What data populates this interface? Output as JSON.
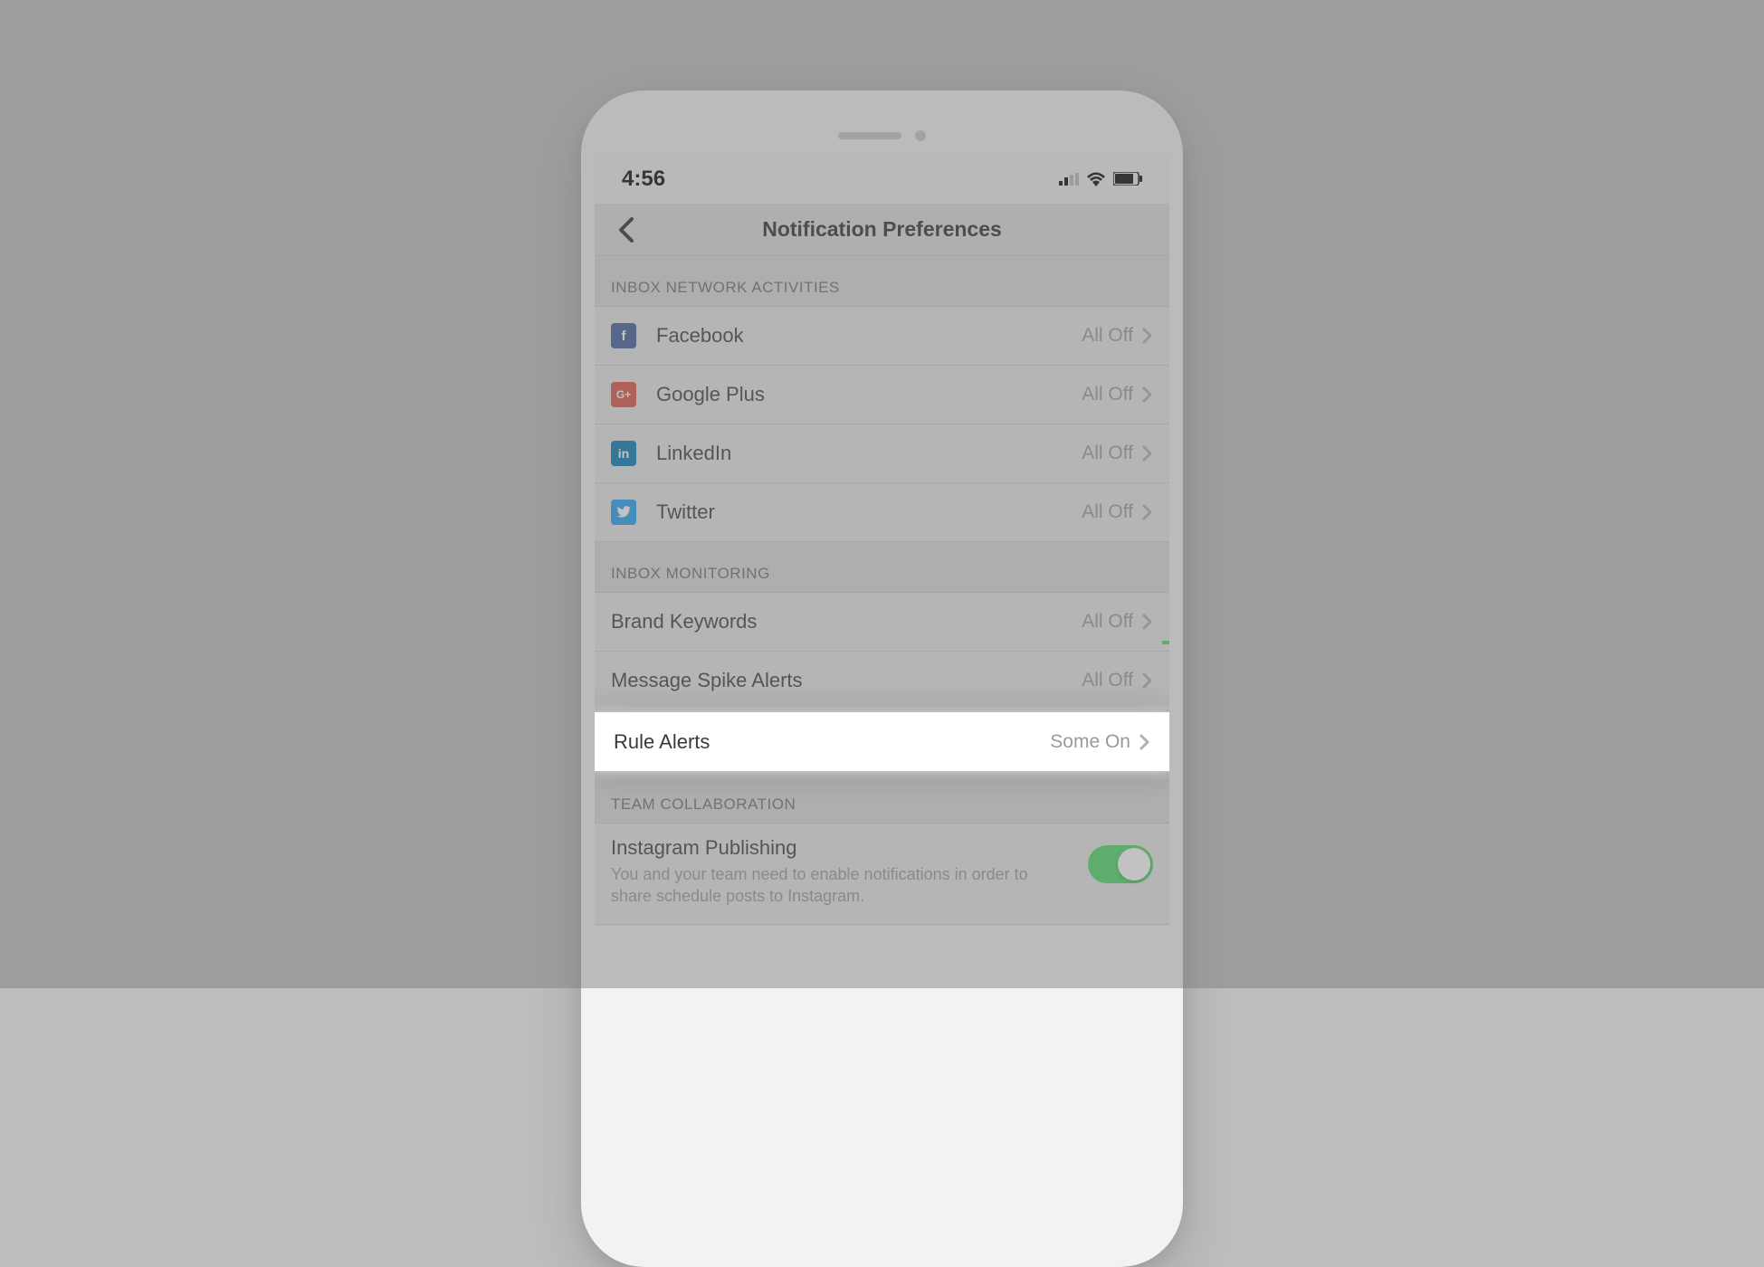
{
  "status_bar": {
    "time": "4:56"
  },
  "nav": {
    "title": "Notification Preferences"
  },
  "sections": [
    {
      "header": "INBOX NETWORK ACTIVITIES",
      "rows": [
        {
          "icon": "facebook",
          "label": "Facebook",
          "status": "All Off"
        },
        {
          "icon": "google-plus",
          "label": "Google Plus",
          "status": "All Off"
        },
        {
          "icon": "linkedin",
          "label": "LinkedIn",
          "status": "All Off"
        },
        {
          "icon": "twitter",
          "label": "Twitter",
          "status": "All Off"
        }
      ]
    },
    {
      "header": "INBOX MONITORING",
      "rows": [
        {
          "icon": null,
          "label": "Brand Keywords",
          "status": "All Off"
        },
        {
          "icon": null,
          "label": "Message Spike Alerts",
          "status": "All Off"
        },
        {
          "icon": null,
          "label": "Rule Alerts",
          "status": "Some On",
          "highlighted": true
        }
      ]
    },
    {
      "header": "TEAM COLLABORATION",
      "items": [
        {
          "title": "Instagram Publishing",
          "description": "You and your team need to enable notifications in order to share schedule posts to Instagram.",
          "toggle": true
        }
      ]
    }
  ],
  "colors": {
    "facebook": "#3b5998",
    "google": "#dc4e41",
    "linkedin": "#0077b5",
    "twitter": "#1da1f2",
    "toggle_on": "#4cd964"
  }
}
